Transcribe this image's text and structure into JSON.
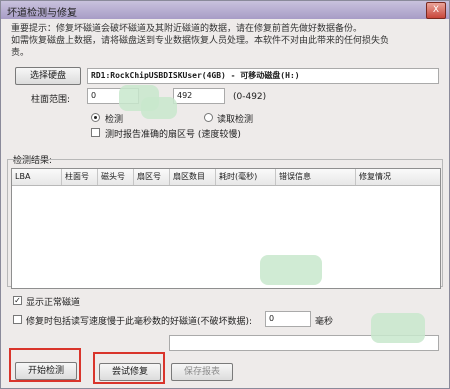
{
  "window": {
    "title": "坏道检测与修复",
    "close_label": "X"
  },
  "notice": {
    "line1": "重要提示：修复坏磁道会破坏磁道及其附近磁道的数据，请在修复前首先做好数据备份。",
    "line2": "如需恢复磁盘上数据，请将磁盘送到专业数据恢复人员处理。本软件不对由此带来的任何损失负",
    "line3": "责。"
  },
  "disk": {
    "select_button": "选择硬盘",
    "selected": "RD1:RockChipUSBDISKUser(4GB) - 可移动磁盘(H:)"
  },
  "cylinder": {
    "label": "柱面范围:",
    "from": "0",
    "to": "492",
    "range_hint": "(0-492)"
  },
  "mode": {
    "option_check": "检测",
    "option_read": "读取检测",
    "slow_sector_label": "测时报告准确的扇区号 (速度较慢)"
  },
  "results": {
    "label": "检测结果:",
    "columns": [
      "LBA",
      "柱面号",
      "磁头号",
      "扇区号",
      "扇区数目",
      "耗时(毫秒)",
      "错误信息",
      "修复情况"
    ]
  },
  "options": {
    "show_normal": "显示正常磁道",
    "repair_slow": "修复时包括读写速度慢于此毫秒数的好磁道(不破坏数据):",
    "ms_value": "0",
    "ms_unit": "毫秒"
  },
  "buttons": {
    "start": "开始检测",
    "try_repair": "尝试修复",
    "save_report": "保存报表"
  },
  "accent_colors": {
    "highlight": "#d9342b",
    "title_bar": "#a79cc6"
  }
}
